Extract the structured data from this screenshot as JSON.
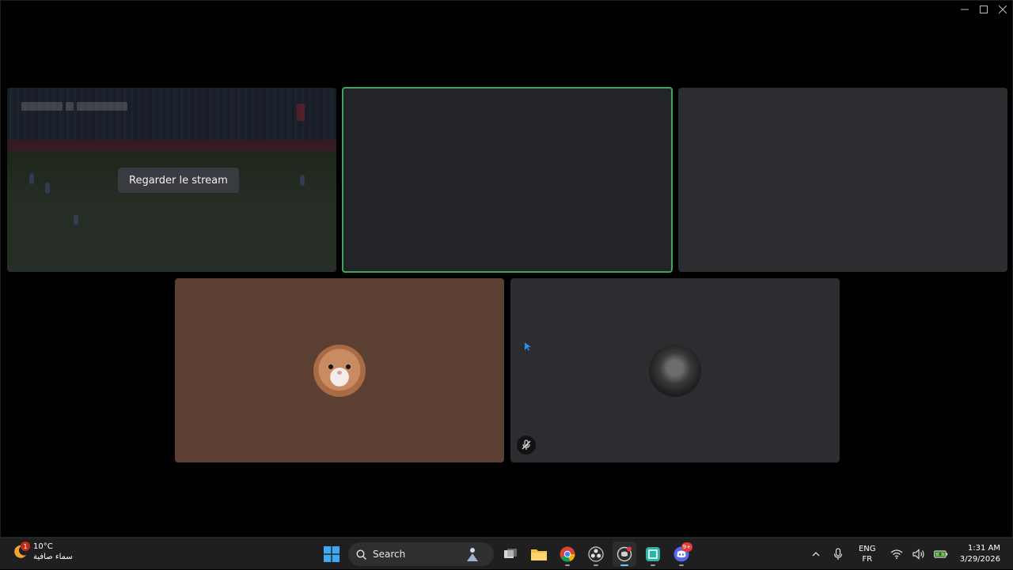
{
  "window": {
    "controls": [
      "minimize",
      "maximize",
      "close"
    ]
  },
  "stream_tile": {
    "watch_button_label": "Regarder le stream"
  },
  "participants": [
    {
      "avatar": "hamster-avatar",
      "bg_color": "#5c3f33"
    },
    {
      "avatar": "dark-avatar",
      "bg_color": "#2b2d31",
      "muted": true
    }
  ],
  "colors": {
    "speaking_border": "#3ba55d",
    "tile_bg": "#2b2d31",
    "taskbar_bg": "#1f1f1f"
  },
  "taskbar": {
    "weather": {
      "temp": "10°C",
      "condition": "سماء صافية",
      "badge": "1"
    },
    "search_label": "Search",
    "apps": [
      "windows-start",
      "search",
      "task-view",
      "file-explorer",
      "chrome",
      "obs",
      "discord-ptb",
      "snipping-tool",
      "discord"
    ],
    "discord_badge": "9+",
    "lang_primary": "ENG",
    "lang_secondary": "FR",
    "time": "1:31 AM",
    "date": "3/29/2026"
  }
}
